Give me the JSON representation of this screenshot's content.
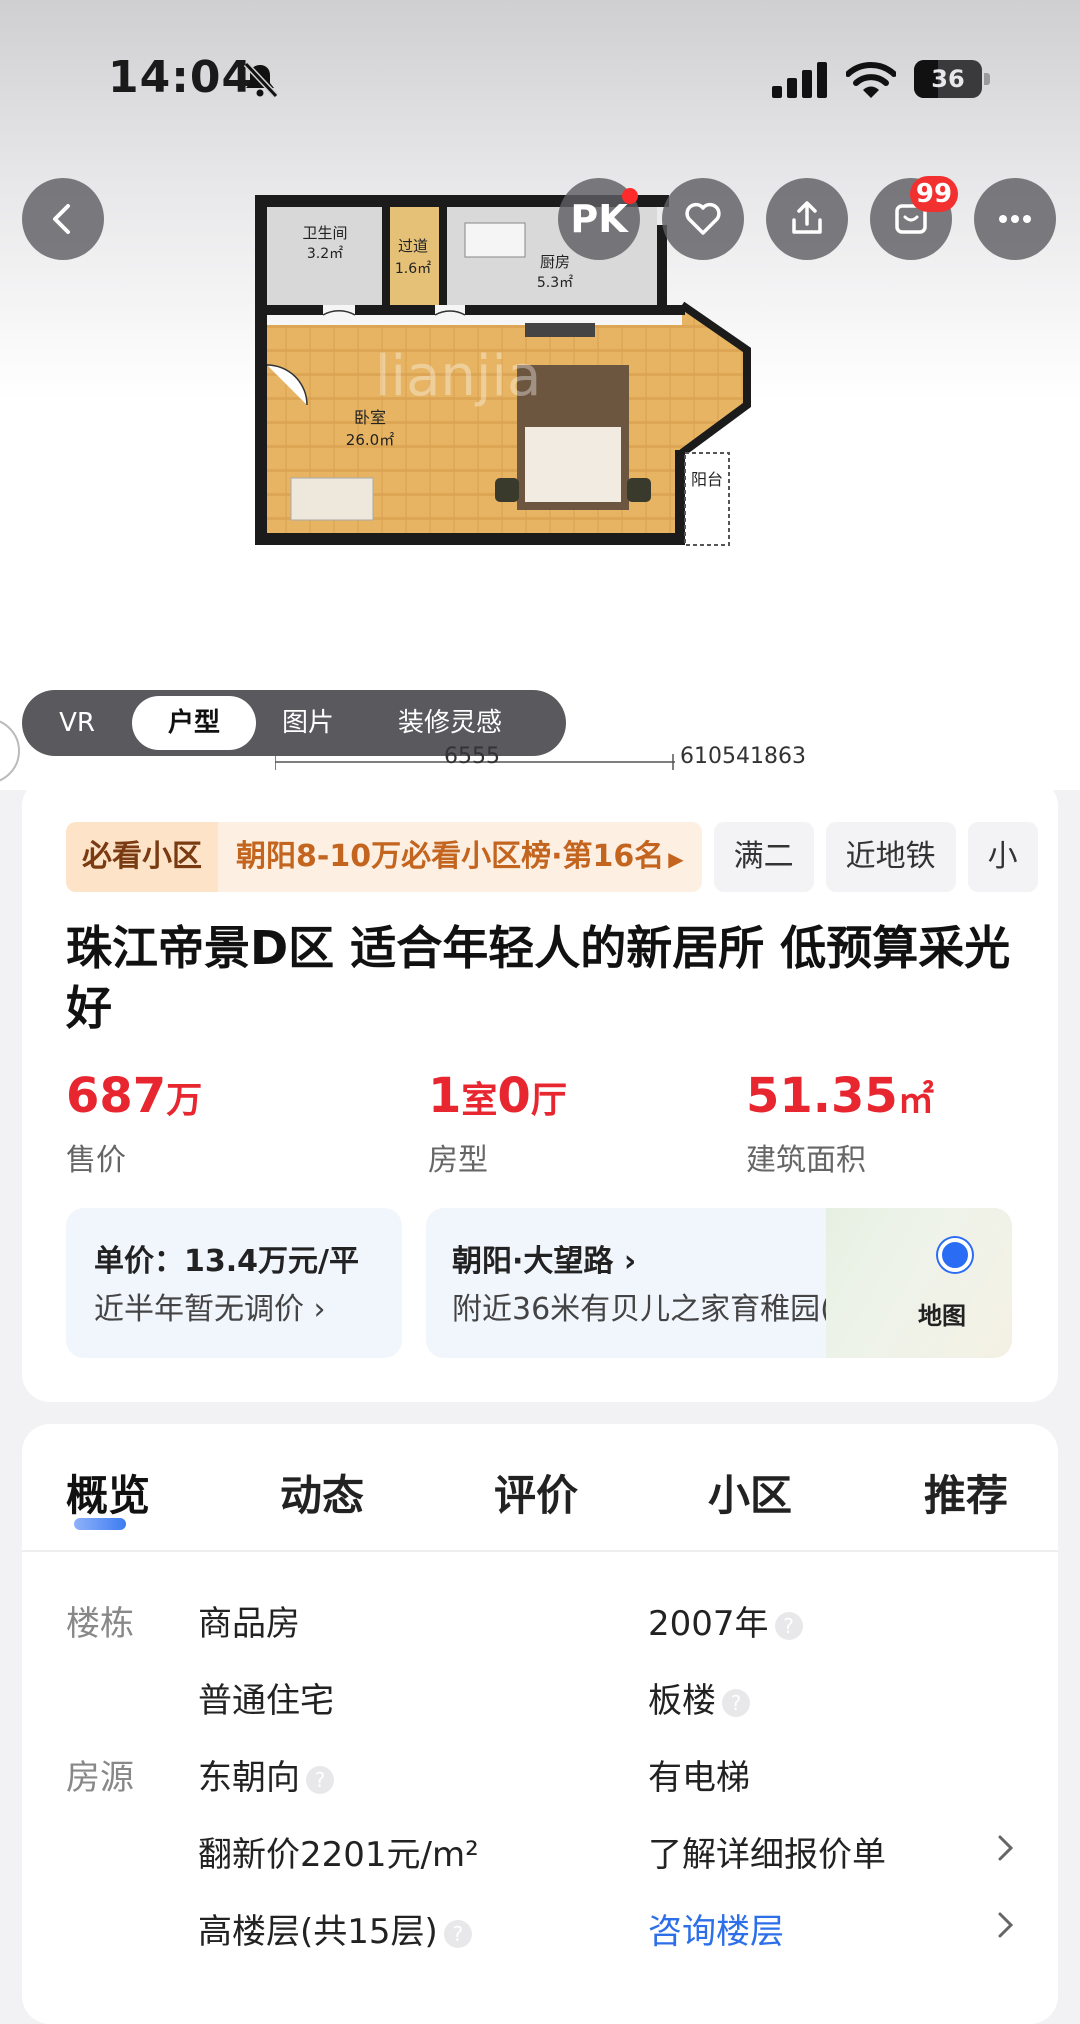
{
  "status_bar": {
    "time": "14:04",
    "battery": "36"
  },
  "header": {
    "pk_label": "PK",
    "msg_badge": "99"
  },
  "floorplan": {
    "rooms": [
      {
        "name": "卫生间",
        "area": "3.2㎡"
      },
      {
        "name": "过道",
        "area": "1.6㎡"
      },
      {
        "name": "厨房",
        "area": "5.3㎡"
      },
      {
        "name": "卧室",
        "area": "26.0㎡"
      },
      {
        "name": "阳台"
      }
    ],
    "watermark": "lianjia",
    "dim_left": "6555",
    "dim_right": "610541863"
  },
  "media_tabs": [
    "VR",
    "户型",
    "图片",
    "装修灵感"
  ],
  "media_tab_active": 1,
  "tags": {
    "rank_head": "必看小区",
    "rank_body": "朝阳8-10万必看小区榜·第16名",
    "chips": [
      "满二",
      "近地铁",
      "小"
    ]
  },
  "listing": {
    "title": "珠江帝景D区 适合年轻人的新居所 低预算采光好",
    "price": {
      "value": "687",
      "unit": "万",
      "label": "售价"
    },
    "layout": {
      "n1": "1",
      "u1": "室",
      "n2": "0",
      "u2": "厅",
      "label": "房型"
    },
    "area": {
      "value": "51.35",
      "unit": "㎡",
      "label": "建筑面积"
    },
    "unit_price": "单价：13.4万元/平",
    "price_note": "近半年暂无调价",
    "location": "朝阳·大望路",
    "nearby": "附近36米有贝儿之家育稚园(...",
    "map_label": "地图"
  },
  "section_tabs": [
    "概览",
    "动态",
    "评价",
    "小区",
    "推荐"
  ],
  "details": {
    "building_label": "楼栋",
    "source_label": "房源",
    "rows": [
      {
        "left": "商品房",
        "right": "2007年"
      },
      {
        "left": "普通住宅",
        "right": "板楼"
      },
      {
        "left": "东朝向",
        "right": "有电梯"
      },
      {
        "left": "翻新价2201元/m²",
        "right": "了解详细报价单"
      },
      {
        "left": "高楼层(共15层)",
        "right": "咨询楼层"
      }
    ]
  },
  "colors": {
    "accent_red": "#e8262f",
    "link_blue": "#2d6fe8",
    "rank_orange": "#c4651f"
  }
}
